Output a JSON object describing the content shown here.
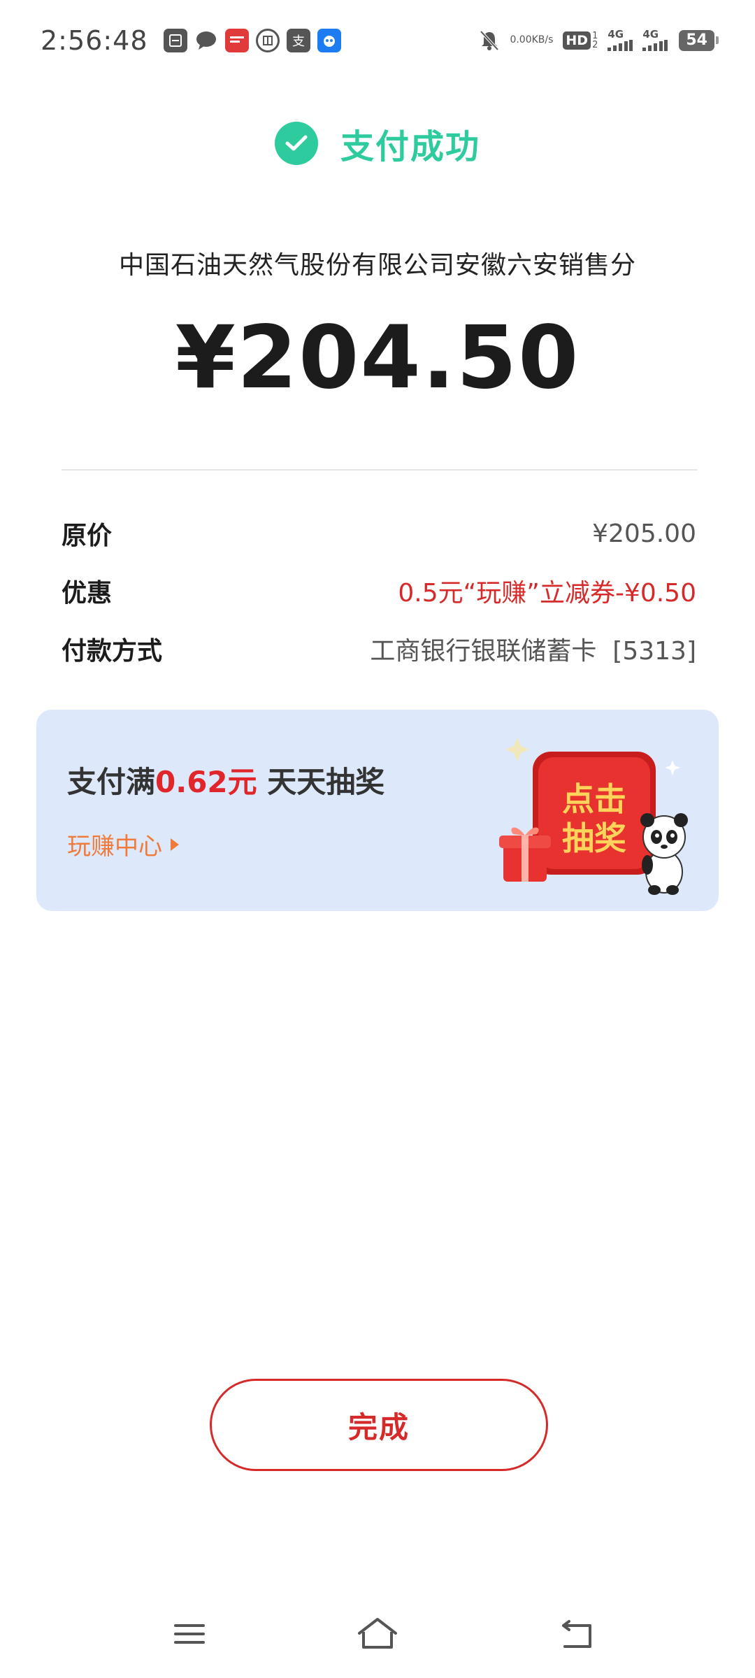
{
  "status_bar": {
    "time": "2:56:48",
    "notification_icons": [
      "scan-icon",
      "chat-bubble-icon",
      "news-icon",
      "bank-icon",
      "alipay-icon",
      "app-icon"
    ],
    "net_speed_value": "0.00",
    "net_speed_unit": "KB/s",
    "hd_label": "HD",
    "sim_numbers": "1\n2",
    "signal1_label": "4G",
    "signal2_label": "4G",
    "battery_level": "54"
  },
  "header": {
    "success_text": "支付成功"
  },
  "payment": {
    "merchant": "中国石油天然气股份有限公司安徽六安销售分",
    "amount": "¥204.50"
  },
  "details": [
    {
      "label": "原价",
      "value": "¥205.00",
      "value_color": "#555555"
    },
    {
      "label": "优惠",
      "value": "0.5元“玩赚”立减券-¥0.50",
      "value_color": "#d62a2a"
    },
    {
      "label": "付款方式",
      "value": "工商银行银联储蓄卡  [5313]",
      "value_color": "#555555"
    }
  ],
  "promo": {
    "title_prefix": "支付满",
    "title_highlight": "0.62元",
    "title_suffix": " 天天抽奖",
    "link_text": "玩赚中心",
    "badge_line1": "点击",
    "badge_line2": "抽奖"
  },
  "done_button": {
    "label": "完成"
  },
  "nav": {
    "icons": [
      "menu-icon",
      "home-icon",
      "back-icon"
    ]
  },
  "colors": {
    "success_green": "#2ecb9f",
    "accent_red": "#d62a2a",
    "promo_bg": "#dde9fb",
    "link_orange": "#f07a3a"
  }
}
